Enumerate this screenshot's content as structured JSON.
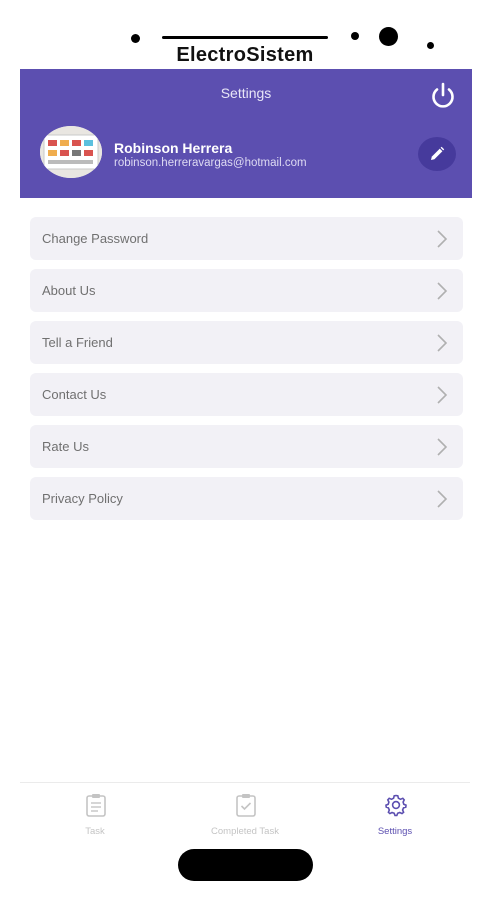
{
  "device": {
    "brand_label": "ElectroSistem"
  },
  "header": {
    "title": "Settings",
    "user_name": "Robinson Herrera",
    "user_email": "robinson.herreravargas@hotmail.com",
    "power_icon": "power-icon",
    "edit_icon": "pencil-icon"
  },
  "menu": {
    "items": [
      {
        "label": "Change Password"
      },
      {
        "label": "About Us"
      },
      {
        "label": "Tell a Friend"
      },
      {
        "label": "Contact Us"
      },
      {
        "label": "Rate Us"
      },
      {
        "label": "Privacy Policy"
      }
    ]
  },
  "bottom_nav": {
    "items": [
      {
        "label": "Task",
        "icon": "clipboard-icon",
        "active": false
      },
      {
        "label": "Completed Task",
        "icon": "clipboard-check-icon",
        "active": false
      },
      {
        "label": "Settings",
        "icon": "gear-icon",
        "active": true
      }
    ]
  },
  "colors": {
    "accent": "#5c4fb0",
    "menu_background": "#f2f1f6",
    "inactive_nav": "#c4c4c4"
  }
}
